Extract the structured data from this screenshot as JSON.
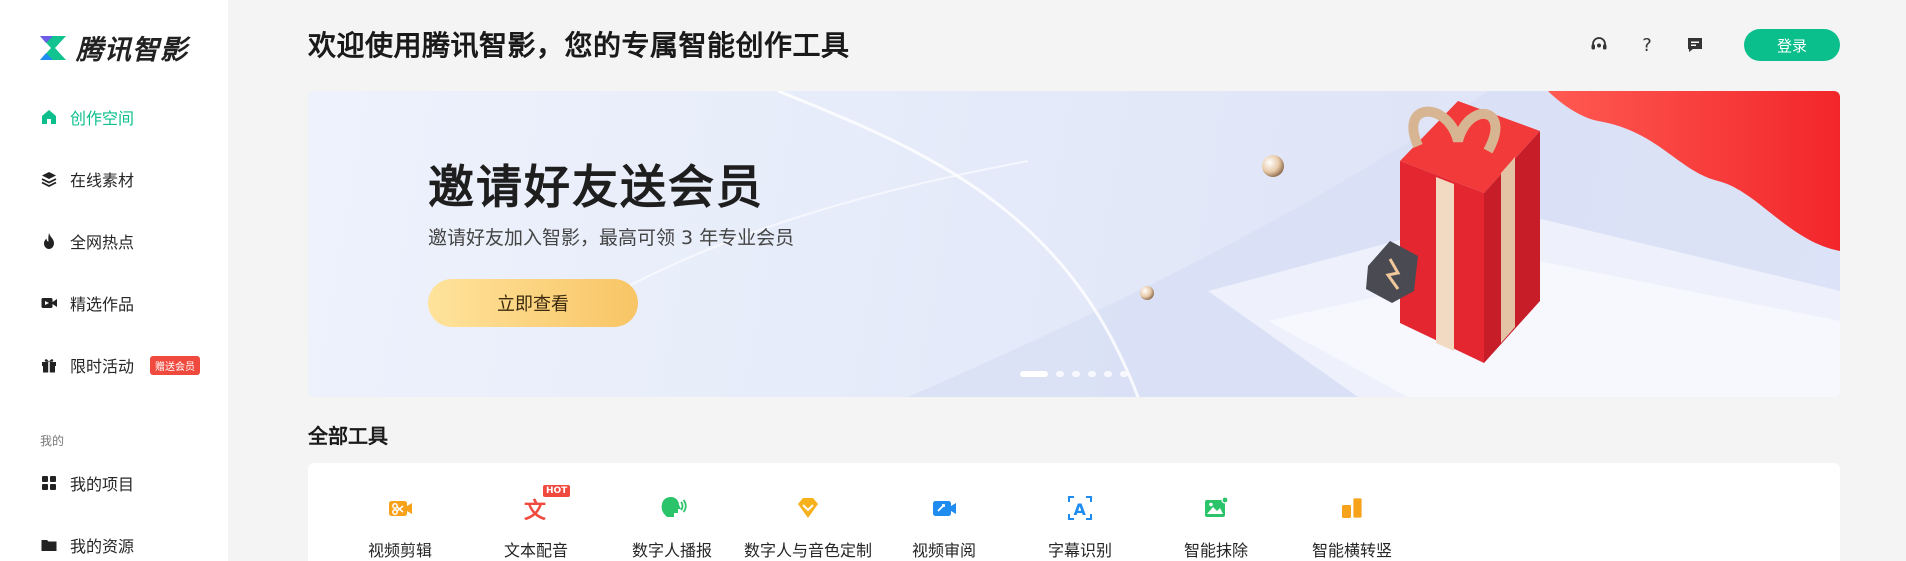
{
  "brand": {
    "name": "腾讯智影",
    "accent": "#0bbf8c"
  },
  "sidebar": {
    "items": [
      {
        "label": "创作空间",
        "icon": "home-icon",
        "active": true
      },
      {
        "label": "在线素材",
        "icon": "layers-icon"
      },
      {
        "label": "全网热点",
        "icon": "fire-icon"
      },
      {
        "label": "精选作品",
        "icon": "video-icon"
      },
      {
        "label": "限时活动",
        "icon": "gift-icon",
        "badge": "赠送会员"
      }
    ],
    "section_label": "我的",
    "my_items": [
      {
        "label": "我的项目",
        "icon": "grid-icon"
      },
      {
        "label": "我的资源",
        "icon": "folder-icon"
      }
    ]
  },
  "header": {
    "title": "欢迎使用腾讯智影，您的专属智能创作工具",
    "icons": [
      "support-icon",
      "help-icon",
      "message-icon"
    ],
    "help_glyph": "?",
    "login_label": "登录"
  },
  "banner": {
    "title": "邀请好友送会员",
    "subtitle": "邀请好友加入智影，最高可领 3 年专业会员",
    "button_label": "立即查看",
    "slide_count": 6,
    "active_slide": 1
  },
  "tools": {
    "title": "全部工具",
    "hot_badge": "HOT",
    "items": [
      {
        "label": "视频剪辑",
        "icon": "scissors-video-icon",
        "color": "#f7a21b"
      },
      {
        "label": "文本配音",
        "icon": "text-voice-icon",
        "color": "#f04a3e",
        "hot": true
      },
      {
        "label": "数字人播报",
        "icon": "digital-human-icon",
        "color": "#2cc46b"
      },
      {
        "label": "数字人与音色定制",
        "icon": "diamond-icon",
        "color": "#f7b21b"
      },
      {
        "label": "视频审阅",
        "icon": "video-review-icon",
        "color": "#1f8cf0"
      },
      {
        "label": "字幕识别",
        "icon": "subtitle-icon",
        "color": "#1f8cf0"
      },
      {
        "label": "智能抹除",
        "icon": "image-erase-icon",
        "color": "#2cc46b"
      },
      {
        "label": "智能横转竖",
        "icon": "orientation-icon",
        "color": "#f7a21b"
      }
    ]
  }
}
